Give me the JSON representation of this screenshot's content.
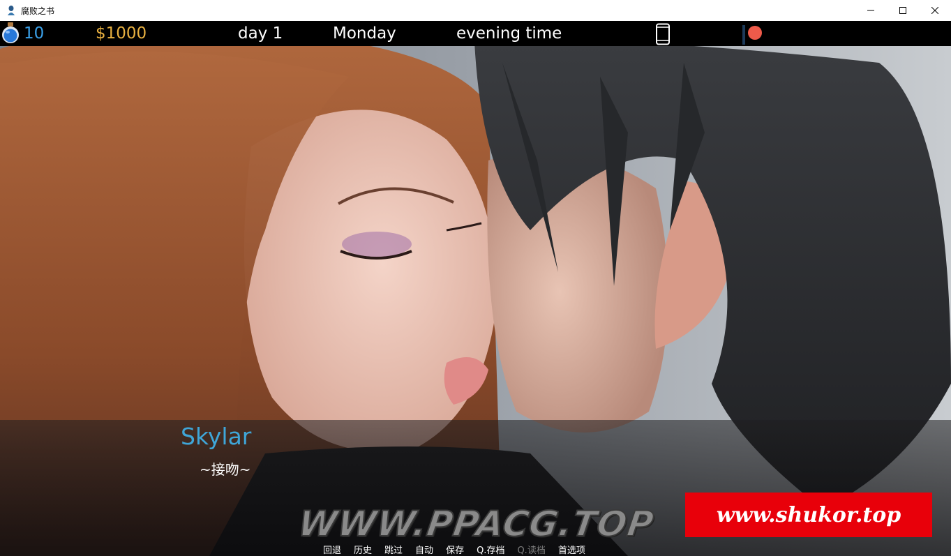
{
  "window": {
    "title": "腐败之书"
  },
  "hud": {
    "energy": "10",
    "money": "$1000",
    "day": "day 1",
    "weekday": "Monday",
    "time_of_day": "evening time",
    "icons": [
      "potion-icon",
      "phone-icon",
      "notification-dot"
    ],
    "colors": {
      "energy": "#3aa0e8",
      "money": "#e8b040",
      "notification": "#ee5a4a"
    }
  },
  "dialogue": {
    "speaker": "Skylar",
    "line": "~接吻~",
    "speaker_color": "#3fa6d8"
  },
  "quick_menu": {
    "items": [
      {
        "label": "回退",
        "enabled": true
      },
      {
        "label": "历史",
        "enabled": true
      },
      {
        "label": "跳过",
        "enabled": true
      },
      {
        "label": "自动",
        "enabled": true
      },
      {
        "label": "保存",
        "enabled": true
      },
      {
        "label": "Q.存档",
        "enabled": true
      },
      {
        "label": "Q.读档",
        "enabled": false
      },
      {
        "label": "首选项",
        "enabled": true
      }
    ]
  },
  "watermarks": {
    "left": "WWW.PPACG.TOP",
    "right": "www.shukor.top"
  }
}
